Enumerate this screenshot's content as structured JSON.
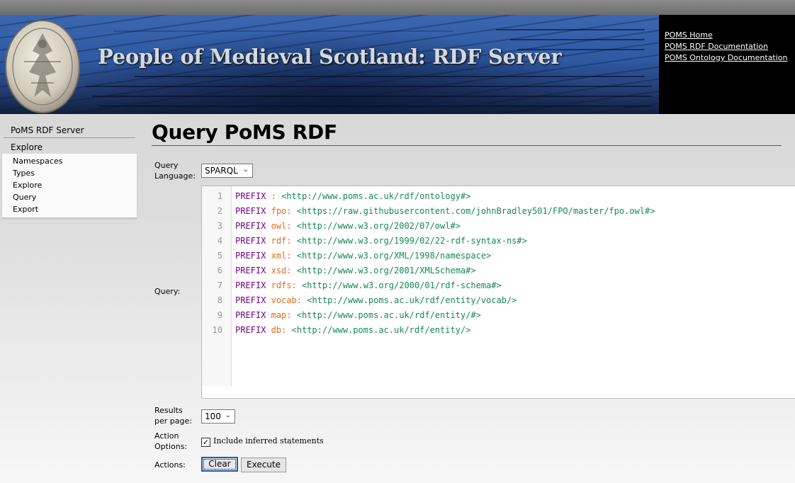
{
  "header": {
    "title": "People of Medieval Scotland: RDF Server",
    "links": [
      "POMS Home",
      "POMS RDF Documentation",
      "POMS Ontology Documentation"
    ]
  },
  "sidebar": {
    "title": "PoMS RDF Server",
    "section": "Explore",
    "items": [
      {
        "label": "Namespaces"
      },
      {
        "label": "Types"
      },
      {
        "label": "Explore"
      },
      {
        "label": "Query"
      },
      {
        "label": "Export"
      }
    ]
  },
  "main": {
    "title": "Query PoMS RDF",
    "query_language_label_1": "Query",
    "query_language_label_2": "Language:",
    "query_language_value": "SPARQL",
    "query_label": "Query:",
    "results_label_1": "Results",
    "results_label_2": "per page:",
    "results_value": "100",
    "action_options_label_1": "Action",
    "action_options_label_2": "Options:",
    "include_inferred_label": "Include inferred statements",
    "include_inferred_checked": true,
    "actions_label": "Actions:",
    "clear_label": "Clear",
    "execute_label": "Execute"
  },
  "query_lines": [
    {
      "n": "1",
      "kw": "PREFIX",
      "prefix": ":",
      "uri": "<http://www.poms.ac.uk/rdf/ontology#>"
    },
    {
      "n": "2",
      "kw": "PREFIX",
      "prefix": "fpo:",
      "uri": "<https://raw.githubusercontent.com/johnBradley501/FPO/master/fpo.owl#>"
    },
    {
      "n": "3",
      "kw": "PREFIX",
      "prefix": "owl:",
      "uri": "<http://www.w3.org/2002/07/owl#>"
    },
    {
      "n": "4",
      "kw": "PREFIX",
      "prefix": "rdf:",
      "uri": "<http://www.w3.org/1999/02/22-rdf-syntax-ns#>"
    },
    {
      "n": "5",
      "kw": "PREFIX",
      "prefix": "xml:",
      "uri": "<http://www.w3.org/XML/1998/namespace>"
    },
    {
      "n": "6",
      "kw": "PREFIX",
      "prefix": "xsd:",
      "uri": "<http://www.w3.org/2001/XMLSchema#>"
    },
    {
      "n": "7",
      "kw": "PREFIX",
      "prefix": "rdfs:",
      "uri": "<http://www.w3.org/2000/01/rdf-schema#>"
    },
    {
      "n": "8",
      "kw": "PREFIX",
      "prefix": "vocab:",
      "uri": "<http://www.poms.ac.uk/rdf/entity/vocab/>"
    },
    {
      "n": "9",
      "kw": "PREFIX",
      "prefix": "map:",
      "uri": "<http://www.poms.ac.uk/rdf/entity/#>"
    },
    {
      "n": "10",
      "kw": "PREFIX",
      "prefix": "db:",
      "uri": "<http://www.poms.ac.uk/rdf/entity/>"
    }
  ]
}
